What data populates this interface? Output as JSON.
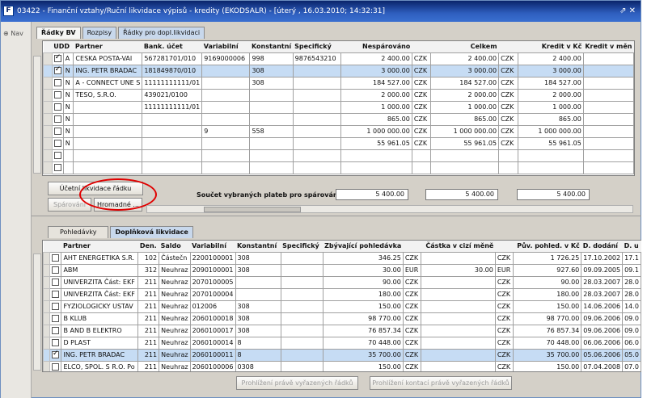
{
  "window": {
    "title": "03422 - Finanční vztahy/Ruční likvidace výpisů - kredity (EKODSALR) - [úterý , 16.03.2010; 14:32:31]",
    "controls": "⇗ ✕"
  },
  "left": {
    "nav_label": "⊕ Nav"
  },
  "top_tabs": [
    {
      "label": "Řádky BV"
    },
    {
      "label": "Rozpisy"
    },
    {
      "label": "Řádky pro dopl.likvidaci"
    }
  ],
  "top_grid": {
    "headers": [
      "UDD",
      "Partner",
      "Bank. účet",
      "Variabilní",
      "Konstantní",
      "Specifický",
      "Nespárováno",
      "",
      "Celkem",
      "",
      "Kredit v Kč",
      "Kredit v měn"
    ],
    "rows": [
      {
        "checked": true,
        "udd": "A",
        "partner": "CESKA POSTA-VAI",
        "account": "567281701/010",
        "variable": "9169000006",
        "constant": "998",
        "specific": "9876543210",
        "unpaired": "2 400.00",
        "cur1": "CZK",
        "total": "2 400.00",
        "cur2": "CZK",
        "credit": "2 400.00",
        "sel": false
      },
      {
        "checked": true,
        "udd": "N",
        "partner": "ING. PETR BRADAC",
        "account": "181849870/010",
        "variable": "",
        "constant": "308",
        "specific": "",
        "unpaired": "3 000.00",
        "cur1": "CZK",
        "total": "3 000.00",
        "cur2": "CZK",
        "credit": "3 000.00",
        "sel": true
      },
      {
        "checked": false,
        "udd": "N",
        "partner": "A - CONNECT UNE S",
        "account": "11111111111/01",
        "variable": "",
        "constant": "308",
        "specific": "",
        "unpaired": "184 527.00",
        "cur1": "CZK",
        "total": "184 527.00",
        "cur2": "CZK",
        "credit": "184 527.00",
        "sel": false
      },
      {
        "checked": false,
        "udd": "N",
        "partner": "TESO, S.R.O.",
        "account": "439021/0100",
        "variable": "",
        "constant": "",
        "specific": "",
        "unpaired": "2 000.00",
        "cur1": "CZK",
        "total": "2 000.00",
        "cur2": "CZK",
        "credit": "2 000.00",
        "sel": false
      },
      {
        "checked": false,
        "udd": "N",
        "partner": "",
        "account": "11111111111/01",
        "variable": "",
        "constant": "",
        "specific": "",
        "unpaired": "1 000.00",
        "cur1": "CZK",
        "total": "1 000.00",
        "cur2": "CZK",
        "credit": "1 000.00",
        "sel": false
      },
      {
        "checked": false,
        "udd": "N",
        "partner": "",
        "account": "",
        "variable": "",
        "constant": "",
        "specific": "",
        "unpaired": "865.00",
        "cur1": "CZK",
        "total": "865.00",
        "cur2": "CZK",
        "credit": "865.00",
        "sel": false
      },
      {
        "checked": false,
        "udd": "N",
        "partner": "",
        "account": "",
        "variable": "9",
        "constant": "558",
        "specific": "",
        "unpaired": "1 000 000.00",
        "cur1": "CZK",
        "total": "1 000 000.00",
        "cur2": "CZK",
        "credit": "1 000 000.00",
        "sel": false
      },
      {
        "checked": false,
        "udd": "N",
        "partner": "",
        "account": "",
        "variable": "",
        "constant": "",
        "specific": "",
        "unpaired": "55 961.05",
        "cur1": "CZK",
        "total": "55 961.05",
        "cur2": "CZK",
        "credit": "55 961.05",
        "sel": false
      },
      {
        "checked": false,
        "udd": "",
        "partner": "",
        "account": "",
        "variable": "",
        "constant": "",
        "specific": "",
        "unpaired": "",
        "cur1": "",
        "total": "",
        "cur2": "",
        "credit": "",
        "sel": false
      },
      {
        "checked": false,
        "udd": "",
        "partner": "",
        "account": "",
        "variable": "",
        "constant": "",
        "specific": "",
        "unpaired": "",
        "cur1": "",
        "total": "",
        "cur2": "",
        "credit": "",
        "sel": false
      }
    ]
  },
  "actions": {
    "accounting_button": "Účetní likvidace řádku",
    "pair_button": "Spárování",
    "bulk_button": "Hromadné ...",
    "sum_label": "Součet vybraných plateb pro spárování",
    "sum_values": [
      "5 400.00",
      "5 400.00",
      "5 400.00"
    ]
  },
  "bottom_tabs": [
    {
      "label": "Pohledávky"
    },
    {
      "label": "Doplňková likvidace"
    }
  ],
  "bottom_grid": {
    "headers": [
      "Partner",
      "Den.",
      "Saldo",
      "Variabilní",
      "Konstantní",
      "Specifický",
      "Zbývající pohledávka",
      "",
      "Částka v cizí měně",
      "",
      "Pův. pohled. v Kč",
      "D. dodání",
      "D. u"
    ],
    "rows": [
      {
        "checked": false,
        "partner": "AHT ENERGETIKA S.R.",
        "days": "102",
        "saldo": "Částečn",
        "variable": "2200100001",
        "constant": "308",
        "specific": "",
        "remaining": "346.25",
        "cur1": "CZK",
        "foreign": "",
        "cur2": "CZK",
        "original": "1 726.25",
        "delivery": "17.10.2002",
        "due": "17.1",
        "sel": false
      },
      {
        "checked": false,
        "partner": "ABM",
        "days": "312",
        "saldo": "Neuhraz",
        "variable": "2090100001",
        "constant": "308",
        "specific": "",
        "remaining": "30.00",
        "cur1": "EUR",
        "foreign": "30.00",
        "cur2": "EUR",
        "original": "927.60",
        "delivery": "09.09.2005",
        "due": "09.1",
        "sel": false
      },
      {
        "checked": false,
        "partner": "UNIVERZITA Část: EKF",
        "days": "211",
        "saldo": "Neuhraz",
        "variable": "2070100005",
        "constant": "",
        "specific": "",
        "remaining": "90.00",
        "cur1": "CZK",
        "foreign": "",
        "cur2": "CZK",
        "original": "90.00",
        "delivery": "28.03.2007",
        "due": "28.0",
        "sel": false
      },
      {
        "checked": false,
        "partner": "UNIVERZITA Část: EKF",
        "days": "211",
        "saldo": "Neuhraz",
        "variable": "2070100004",
        "constant": "",
        "specific": "",
        "remaining": "180.00",
        "cur1": "CZK",
        "foreign": "",
        "cur2": "CZK",
        "original": "180.00",
        "delivery": "28.03.2007",
        "due": "28.0",
        "sel": false
      },
      {
        "checked": false,
        "partner": "FYZIOLOGICKY USTAV",
        "days": "211",
        "saldo": "Neuhraz",
        "variable": "012006",
        "constant": "308",
        "specific": "",
        "remaining": "150.00",
        "cur1": "CZK",
        "foreign": "",
        "cur2": "CZK",
        "original": "150.00",
        "delivery": "14.06.2006",
        "due": "14.0",
        "sel": false
      },
      {
        "checked": false,
        "partner": "B KLUB",
        "days": "211",
        "saldo": "Neuhraz",
        "variable": "2060100018",
        "constant": "308",
        "specific": "",
        "remaining": "98 770.00",
        "cur1": "CZK",
        "foreign": "",
        "cur2": "CZK",
        "original": "98 770.00",
        "delivery": "09.06.2006",
        "due": "09.0",
        "sel": false
      },
      {
        "checked": false,
        "partner": "B AND B ELEKTRO",
        "days": "211",
        "saldo": "Neuhraz",
        "variable": "2060100017",
        "constant": "308",
        "specific": "",
        "remaining": "76 857.34",
        "cur1": "CZK",
        "foreign": "",
        "cur2": "CZK",
        "original": "76 857.34",
        "delivery": "09.06.2006",
        "due": "09.0",
        "sel": false
      },
      {
        "checked": false,
        "partner": "D PLAST",
        "days": "211",
        "saldo": "Neuhraz",
        "variable": "2060100014",
        "constant": "8",
        "specific": "",
        "remaining": "70 448.00",
        "cur1": "CZK",
        "foreign": "",
        "cur2": "CZK",
        "original": "70 448.00",
        "delivery": "06.06.2006",
        "due": "06.0",
        "sel": false
      },
      {
        "checked": true,
        "partner": "ING. PETR BRADAC",
        "days": "211",
        "saldo": "Neuhraz",
        "variable": "2060100011",
        "constant": "8",
        "specific": "",
        "remaining": "35 700.00",
        "cur1": "CZK",
        "foreign": "",
        "cur2": "CZK",
        "original": "35 700.00",
        "delivery": "05.06.2006",
        "due": "05.0",
        "sel": true
      },
      {
        "checked": false,
        "partner": "ELCO, SPOL. S R.O. Po",
        "days": "211",
        "saldo": "Neuhraz",
        "variable": "2060100006",
        "constant": "0308",
        "specific": "",
        "remaining": "150.00",
        "cur1": "CZK",
        "foreign": "",
        "cur2": "CZK",
        "original": "150.00",
        "delivery": "07.04.2008",
        "due": "07.0",
        "sel": false
      }
    ]
  },
  "bottom_buttons": {
    "view_selected": "Prohlížení právě vyřazených řádků",
    "view_accounting": "Prohlížení kontací právě vyřazených řádků"
  }
}
